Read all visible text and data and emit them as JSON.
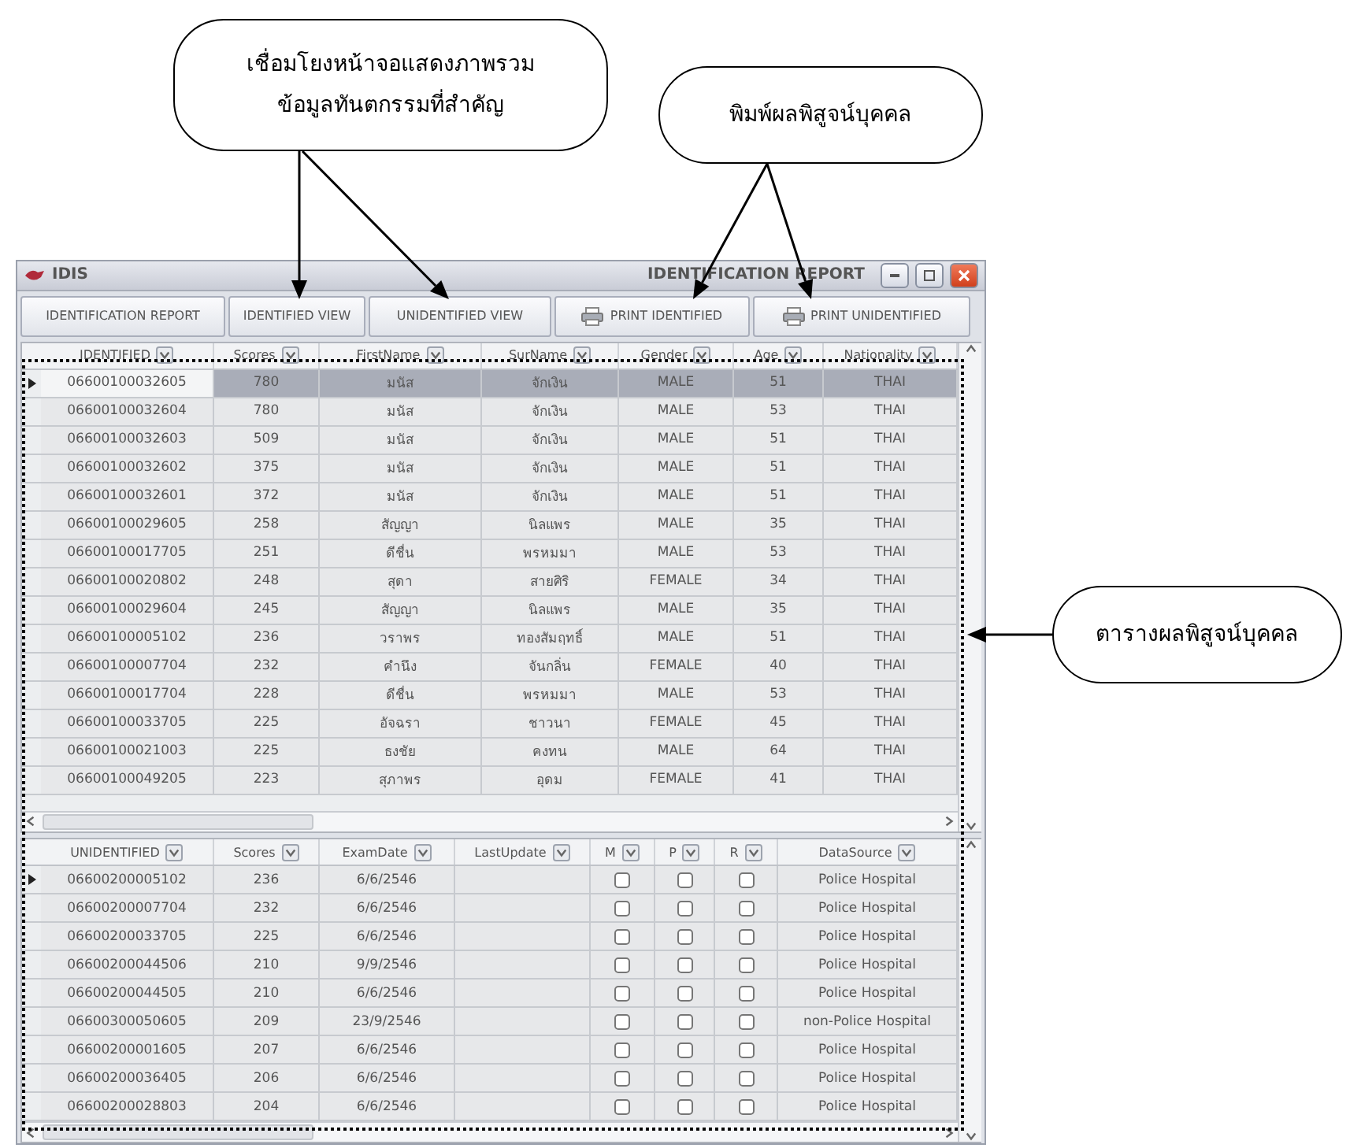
{
  "callouts": [
    {
      "lines": [
        "เชื่อมโยงหน้าจอแสดงภาพรวม",
        "ข้อมูลทันตกรรมที่สำคัญ"
      ]
    },
    {
      "lines": [
        "พิมพ์ผลพิสูจน์บุคคล"
      ]
    },
    {
      "lines": [
        "ตารางผลพิสูจน์บุคคล"
      ]
    }
  ],
  "window": {
    "app_name": "IDIS",
    "title": "IDENTIFICATION REPORT"
  },
  "toolbar": [
    {
      "label": "IDENTIFICATION REPORT",
      "kind": "plain"
    },
    {
      "label": "IDENTIFIED VIEW",
      "kind": "plain"
    },
    {
      "label": "UNIDENTIFIED VIEW",
      "kind": "plain"
    },
    {
      "label": "PRINT IDENTIFIED",
      "kind": "print"
    },
    {
      "label": "PRINT UNIDENTIFIED",
      "kind": "print"
    }
  ],
  "identified_table": {
    "columns": [
      "IDENTIFIED",
      "Scores",
      "FirstName",
      "SurName",
      "Gender",
      "Age",
      "Nationality"
    ],
    "rows": [
      {
        "cells": [
          "06600100032605",
          "780",
          "มนัส",
          "จักเงิน",
          "MALE",
          "51",
          "THAI"
        ],
        "selected": true
      },
      {
        "cells": [
          "06600100032604",
          "780",
          "มนัส",
          "จักเงิน",
          "MALE",
          "53",
          "THAI"
        ],
        "selected": false
      },
      {
        "cells": [
          "06600100032603",
          "509",
          "มนัส",
          "จักเงิน",
          "MALE",
          "51",
          "THAI"
        ],
        "selected": false
      },
      {
        "cells": [
          "06600100032602",
          "375",
          "มนัส",
          "จักเงิน",
          "MALE",
          "51",
          "THAI"
        ],
        "selected": false
      },
      {
        "cells": [
          "06600100032601",
          "372",
          "มนัส",
          "จักเงิน",
          "MALE",
          "51",
          "THAI"
        ],
        "selected": false
      },
      {
        "cells": [
          "06600100029605",
          "258",
          "สัญญา",
          "นิลแพร",
          "MALE",
          "35",
          "THAI"
        ],
        "selected": false
      },
      {
        "cells": [
          "06600100017705",
          "251",
          "ดีชื่น",
          "พรหมมา",
          "MALE",
          "53",
          "THAI"
        ],
        "selected": false
      },
      {
        "cells": [
          "06600100020802",
          "248",
          "สุดา",
          "สายศิริ",
          "FEMALE",
          "34",
          "THAI"
        ],
        "selected": false
      },
      {
        "cells": [
          "06600100029604",
          "245",
          "สัญญา",
          "นิลแพร",
          "MALE",
          "35",
          "THAI"
        ],
        "selected": false
      },
      {
        "cells": [
          "06600100005102",
          "236",
          "วราพร",
          "ทองสัมฤทธิ์",
          "MALE",
          "51",
          "THAI"
        ],
        "selected": false
      },
      {
        "cells": [
          "06600100007704",
          "232",
          "คำนึง",
          "จันกลิ่น",
          "FEMALE",
          "40",
          "THAI"
        ],
        "selected": false
      },
      {
        "cells": [
          "06600100017704",
          "228",
          "ดีชื่น",
          "พรหมมา",
          "MALE",
          "53",
          "THAI"
        ],
        "selected": false
      },
      {
        "cells": [
          "06600100033705",
          "225",
          "อัจฉรา",
          "ชาวนา",
          "FEMALE",
          "45",
          "THAI"
        ],
        "selected": false
      },
      {
        "cells": [
          "06600100021003",
          "225",
          "ธงชัย",
          "คงทน",
          "MALE",
          "64",
          "THAI"
        ],
        "selected": false
      },
      {
        "cells": [
          "06600100049205",
          "223",
          "สุภาพร",
          "อุดม",
          "FEMALE",
          "41",
          "THAI"
        ],
        "selected": false
      }
    ]
  },
  "unidentified_table": {
    "columns": [
      "UNIDENTIFIED",
      "Scores",
      "ExamDate",
      "LastUpdate",
      "M",
      "P",
      "R",
      "DataSource"
    ],
    "rows": [
      {
        "id": "06600200005102",
        "score": "236",
        "exam_date": "6/6/2546",
        "m": false,
        "p": false,
        "r": false,
        "data_source": "Police Hospital",
        "selected": true
      },
      {
        "id": "06600200007704",
        "score": "232",
        "exam_date": "6/6/2546",
        "m": false,
        "p": false,
        "r": false,
        "data_source": "Police Hospital",
        "selected": false
      },
      {
        "id": "06600200033705",
        "score": "225",
        "exam_date": "6/6/2546",
        "m": false,
        "p": false,
        "r": false,
        "data_source": "Police Hospital",
        "selected": false
      },
      {
        "id": "06600200044506",
        "score": "210",
        "exam_date": "9/9/2546",
        "m": false,
        "p": false,
        "r": false,
        "data_source": "Police Hospital",
        "selected": false
      },
      {
        "id": "06600200044505",
        "score": "210",
        "exam_date": "6/6/2546",
        "m": false,
        "p": false,
        "r": false,
        "data_source": "Police Hospital",
        "selected": false
      },
      {
        "id": "06600300050605",
        "score": "209",
        "exam_date": "23/9/2546",
        "m": false,
        "p": false,
        "r": false,
        "data_source": "non-Police Hospital",
        "selected": false
      },
      {
        "id": "06600200001605",
        "score": "207",
        "exam_date": "6/6/2546",
        "m": false,
        "p": false,
        "r": false,
        "data_source": "Police Hospital",
        "selected": false
      },
      {
        "id": "06600200036405",
        "score": "206",
        "exam_date": "6/6/2546",
        "m": false,
        "p": false,
        "r": false,
        "data_source": "Police Hospital",
        "selected": false
      },
      {
        "id": "06600200028803",
        "score": "204",
        "exam_date": "6/6/2546",
        "m": false,
        "p": false,
        "r": false,
        "data_source": "Police Hospital",
        "selected": false
      }
    ]
  }
}
